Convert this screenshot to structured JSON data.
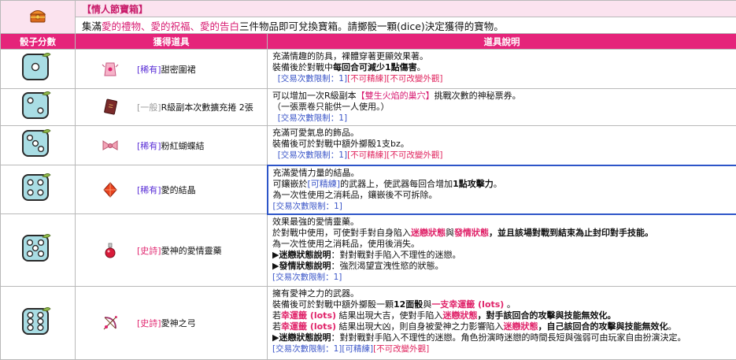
{
  "box": {
    "icon": "treasure-box-icon",
    "title": "【情人節寶箱】",
    "desc_prefix": "集滿",
    "desc_items": "愛的禮物、愛的祝福、愛的告白",
    "desc_suffix": "三件物品即可兌換寶箱。請擲骰一顆(dice)決定獲得的寶物。"
  },
  "columns": {
    "dice": "骰子分數",
    "item": "獲得道具",
    "desc": "道具說明"
  },
  "rows": [
    {
      "dice": 1,
      "icon": "apron-icon",
      "tag": "[稀有]",
      "name": "甜密圍裙",
      "lines": [
        "充滿情趣的防具，裸體穿著更顯效果著。",
        "裝備後於對戰中",
        "每回合可減少1點傷害",
        "。"
      ],
      "r1": "[交易次數限制：1]",
      "r2": "[不可精練]",
      "r3": "[不可改變外觀]"
    },
    {
      "dice": 2,
      "icon": "scroll-book-icon",
      "tag": "[一般]",
      "name": "R級副本次數擴充捲 2張",
      "l1a": "可以增加一次R級副本",
      "l1b": "【雙生火焰的巢穴】",
      "l1c": "挑戰次數的神秘票券。",
      "l2": "（一張票卷只能供一人使用。）",
      "r1": "[交易次數限制：1]"
    },
    {
      "dice": 3,
      "icon": "bow-tie-icon",
      "tag": "[稀有]",
      "name": "粉紅蝴蝶結",
      "l1": "充滿可愛氣息的飾品。",
      "l2": "裝備後可於對戰中額外擲骰1支bz。",
      "r1": "[交易次數限制：1]",
      "r2": "[不可精練]",
      "r3": "[不可改變外觀]"
    },
    {
      "dice": 4,
      "icon": "crystal-icon",
      "tag": "[稀有]",
      "name": "愛的結晶",
      "l1": "充滿愛情力量的結晶。",
      "l2a": "可鑲嵌於",
      "l2b": "[可精練]",
      "l2c": "的武器上，使武器每回合增加",
      "l2d": "1點攻擊力",
      "l2e": "。",
      "l3": "為一次性使用之消耗品，鑲嵌後不可拆除。",
      "r1": "[交易次數限制：1]"
    },
    {
      "dice": 5,
      "icon": "potion-icon",
      "tag": "[史詩]",
      "name": "愛神的愛情靈藥",
      "l1": "效果最強的愛情靈藥。",
      "l2a": "於對戰中使用，可使對手對自身陷入",
      "l2b": "迷戀狀態",
      "l2c": "與",
      "l2d": "發情狀態",
      "l2e": "，並且該場對戰到結束為止封印對手技能。",
      "l3": "為一次性使用之消耗品，使用後消失。",
      "l4a": "▶迷戀狀態說明",
      "l4b": "：對對戰對手陷入不理性的迷戀。",
      "l5a": "▶發情狀態說明",
      "l5b": "：強烈渴望宣洩性慾的狀態。",
      "r1": "[交易次數限制：1]"
    },
    {
      "dice": 6,
      "icon": "cupid-bow-icon",
      "tag": "[史詩]",
      "name": "愛神之弓",
      "l1": "擁有愛神之力的武器。",
      "l2a": "裝備後可於對戰中額外擲骰一顆",
      "l2b": "12面骰",
      "l2c": "與",
      "l2d": "一支幸運籤 (lots)",
      "l2e": " 。",
      "l3a": "若",
      "l3b": "幸運籤 (lots)",
      "l3c": " 結果出現大吉，使對手陷入",
      "l3d": "迷戀狀態",
      "l3e": "，對手該回合的攻擊與技能無效化。",
      "l4a": "若",
      "l4b": "幸運籤 (lots)",
      "l4c": " 結果出現大凶，則自身被愛神之力影響陷入",
      "l4d": "迷戀狀態",
      "l4e": "，自己該回合的攻擊與技能無效化",
      "l4f": "。",
      "l5a": "▶迷戀狀態說明",
      "l5b": "：對對戰對手陷入不理性的迷戀。角色扮演時迷戀的時間長短與強弱可由玩家自由扮演決定。",
      "r1": "[交易次數限制：1]",
      "r2": "[可精練]",
      "r3": "[不可改變外觀]"
    }
  ],
  "colors": {
    "header_bg": "#fbe3ef",
    "column_header": "#e5247a",
    "die_face": "#a9dde4",
    "pip": "#ffffff",
    "accent_pink": "#d81b72",
    "restrict_blue": "#3a55c8"
  }
}
